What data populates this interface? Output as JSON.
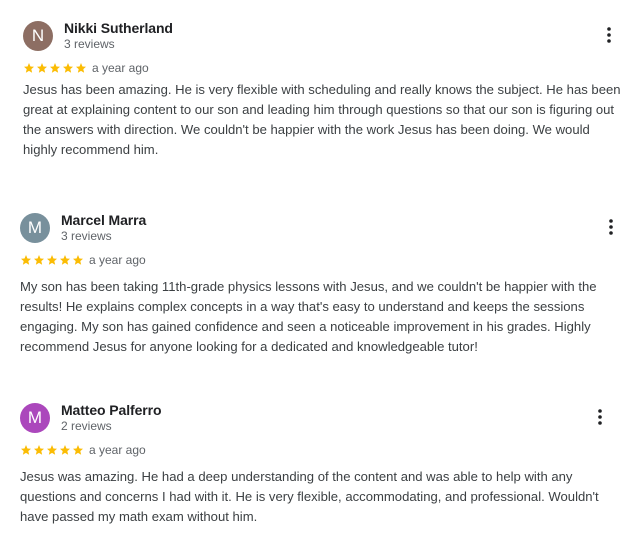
{
  "reviews": [
    {
      "avatar_letter": "N",
      "avatar_color": "#8d6e63",
      "name": "Nikki Sutherland",
      "review_count": "3 reviews",
      "rating": 5,
      "date": "a year ago",
      "text": "Jesus has been amazing. He is very flexible with scheduling and really knows the subject. He has been great at explaining content to our son and leading him through questions so that our son is figuring out the answers with direction. We couldn't be happier with the work Jesus has been doing. We would highly recommend him.",
      "menu_icon": "more-vert-icon"
    },
    {
      "avatar_letter": "M",
      "avatar_color": "#78909c",
      "name": "Marcel Marra",
      "review_count": "3 reviews",
      "rating": 5,
      "date": "a year ago",
      "text": "My son has been taking 11th-grade physics lessons with Jesus, and we couldn't be happier with the results! He explains complex concepts in a way that's easy to understand and keeps the sessions engaging. My son has gained confidence and seen a noticeable improvement in his grades. Highly recommend Jesus for anyone looking for a dedicated and knowledgeable tutor!",
      "menu_icon": "more-vert-icon"
    },
    {
      "avatar_letter": "M",
      "avatar_color": "#ab47bc",
      "name": "Matteo Palferro",
      "review_count": "2 reviews",
      "rating": 5,
      "date": "a year ago",
      "text": "Jesus was amazing. He had a deep understanding of the content and was able to help with any questions and concerns I had with it. He is very flexible, accommodating, and professional. Wouldn't have passed my math exam without him.",
      "menu_icon": "more-vert-icon"
    }
  ],
  "colors": {
    "star": "#fbbc04",
    "name": "#202124",
    "meta": "#5f6368",
    "body_text": "#3c4043"
  }
}
